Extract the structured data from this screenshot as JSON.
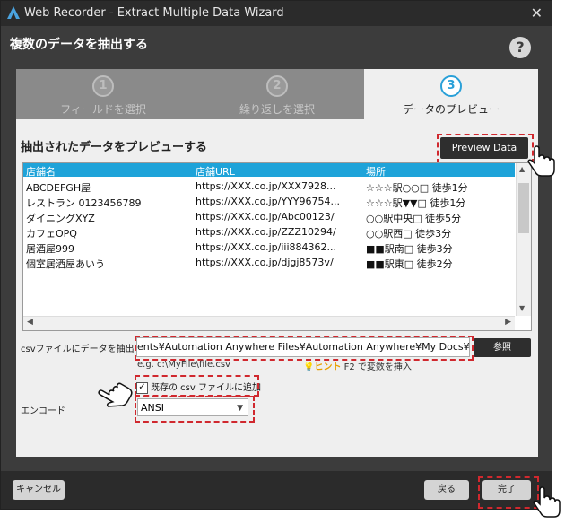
{
  "window": {
    "title": "Web Recorder - Extract Multiple Data Wizard",
    "heading": "複数のデータを抽出する",
    "help": "?"
  },
  "steps": [
    {
      "num": "1",
      "label": "フィールドを選択"
    },
    {
      "num": "2",
      "label": "繰り返しを選択"
    },
    {
      "num": "3",
      "label": "データのプレビュー"
    }
  ],
  "panel": {
    "title": "抽出されたデータをプレビューする",
    "preview_button": "Preview Data"
  },
  "table": {
    "columns": [
      "店舗名",
      "店舗URL",
      "場所"
    ],
    "rows": [
      [
        "ABCDEFGH屋",
        "https://XXX.co.jp/XXX7928...",
        "☆☆☆駅○○□ 徒歩1分"
      ],
      [
        "レストラン 0123456789",
        "https://XXX.co.jp/YYY96754...",
        "☆☆☆駅▼▼□ 徒歩1分"
      ],
      [
        "ダイニングXYZ",
        "https://XXX.co.jp/Abc00123/",
        "○○駅中央□ 徒歩5分"
      ],
      [
        "カフェOPQ",
        "https://XXX.co.jp/ZZZ10294/",
        "○○駅西□ 徒歩3分"
      ],
      [
        "居酒屋999",
        "https://XXX.co.jp/iii884362...",
        "■■駅南□ 徒歩3分"
      ],
      [
        "個室居酒屋あいう",
        "https://XXX.co.jp/djgj8573v/",
        "■■駅東□ 徒歩2分"
      ]
    ]
  },
  "csv": {
    "label": "csvファイルにデータを抽出する",
    "value": "ents¥Automation Anywhere Files¥Automation Anywhere¥My Docs¥pattern.csv",
    "browse": "参照",
    "example": "e.g. c:\\MyFile\\file.csv",
    "hint_label": "ヒント",
    "hint_text": "F2 で変数を挿入",
    "append_label": "既存の csv ファイルに追加",
    "append_checked": "✓"
  },
  "encoding": {
    "label": "エンコード",
    "value": "ANSI"
  },
  "buttons": {
    "cancel": "キャンセル",
    "back": "戻る",
    "finish": "完了"
  }
}
